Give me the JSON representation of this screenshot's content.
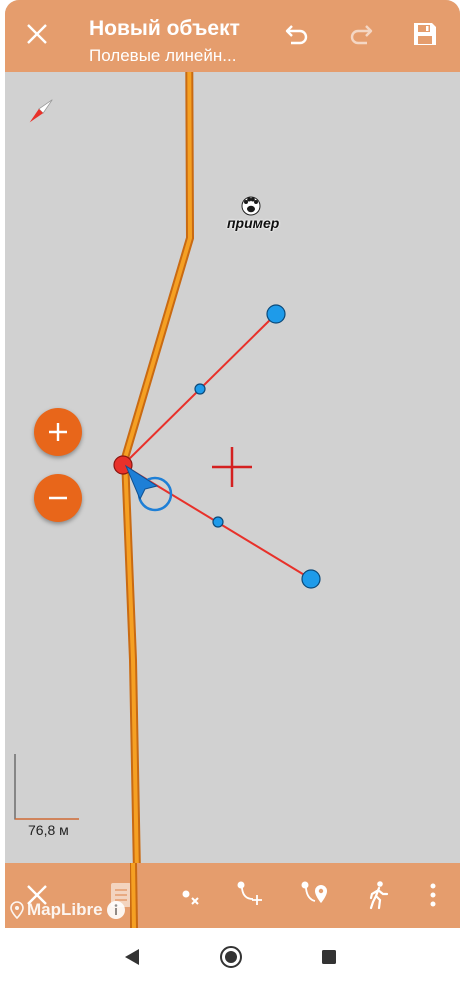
{
  "toolbar": {
    "title": "Новый объект",
    "subtitle": "Полевые линейн...",
    "close_icon": "close-icon",
    "undo_icon": "undo-icon",
    "redo_icon": "redo-icon",
    "save_icon": "save-icon"
  },
  "map": {
    "poi_label": "пример",
    "scale_label": "76,8 м",
    "attribution": "MapLibre",
    "colors": {
      "background": "#d1d1d1",
      "road_fill": "#f5a023",
      "road_casing": "#c96a12",
      "edit_line": "#e8312a",
      "vertex": "#1e9bea",
      "accent": "#e8661a"
    }
  },
  "bottom_toolbar": {
    "items": [
      "close-icon",
      "document-icon",
      "delete-vertex-icon",
      "add-vertex-icon",
      "add-point-icon",
      "walk-mode-icon",
      "more-icon"
    ]
  },
  "system_nav": {
    "items": [
      "back-icon",
      "home-icon",
      "recents-icon"
    ]
  }
}
